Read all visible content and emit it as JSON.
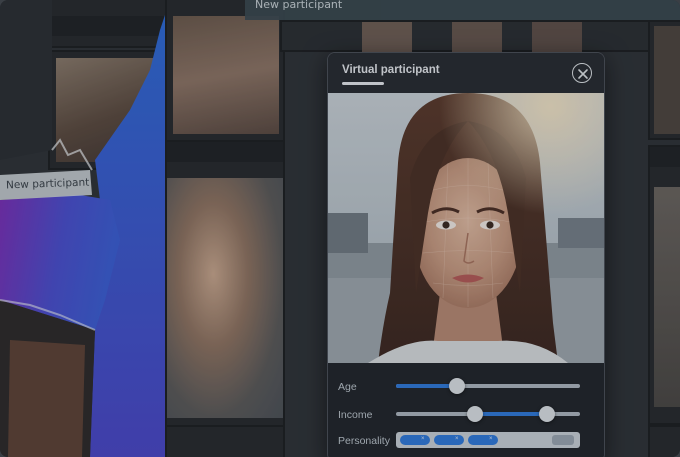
{
  "top_strip": {
    "label": "New participant"
  },
  "collage": {
    "torn_label": "New participant"
  },
  "modal": {
    "title": "Virtual participant",
    "controls": {
      "age": {
        "label": "Age",
        "value_fraction": 0.33
      },
      "income": {
        "label": "Income",
        "range_fraction": [
          0.43,
          0.82
        ]
      },
      "personality": {
        "label": "Personality"
      }
    }
  },
  "colors": {
    "accent": "#2f7bdc",
    "modal_bg": "#1e2227",
    "gradient_purple": "#7a2fb8",
    "gradient_blue": "#3a5fd6"
  },
  "icons": {
    "close": "close-circle-icon"
  }
}
